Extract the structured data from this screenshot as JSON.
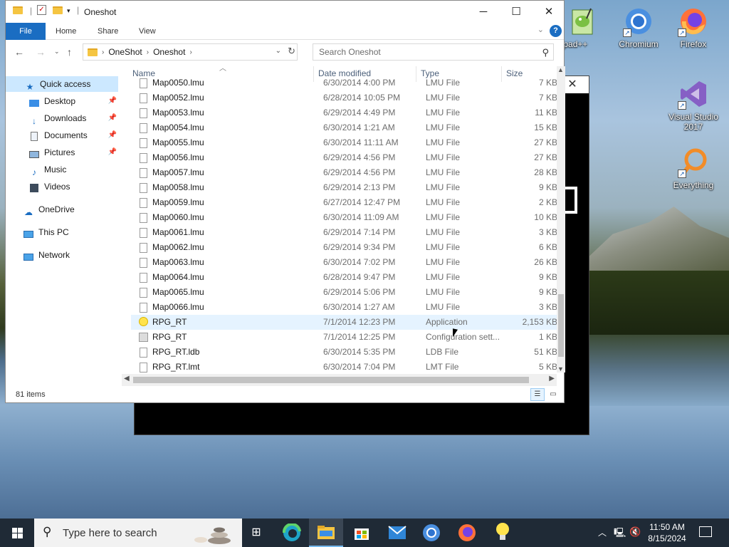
{
  "explorer": {
    "title": "Oneshot",
    "ribbon_tabs": [
      "File",
      "Home",
      "Share",
      "View"
    ],
    "address_path": [
      "OneShot",
      "Oneshot"
    ],
    "search_placeholder": "Search Oneshot",
    "columns": [
      "Name",
      "Date modified",
      "Type",
      "Size"
    ],
    "sidebar": [
      {
        "label": "Quick access",
        "icon": "star-icon",
        "active": true
      },
      {
        "label": "Desktop",
        "icon": "desktop-icon",
        "pinned": true
      },
      {
        "label": "Downloads",
        "icon": "download-icon",
        "pinned": true
      },
      {
        "label": "Documents",
        "icon": "documents-icon",
        "pinned": true
      },
      {
        "label": "Pictures",
        "icon": "pictures-icon",
        "pinned": true
      },
      {
        "label": "Music",
        "icon": "music-icon"
      },
      {
        "label": "Videos",
        "icon": "videos-icon"
      },
      {
        "label": "OneDrive",
        "icon": "cloud-icon"
      },
      {
        "label": "This PC",
        "icon": "computer-icon"
      },
      {
        "label": "Network",
        "icon": "network-icon"
      }
    ],
    "files": [
      {
        "name": "Map0050.lmu",
        "date": "6/30/2014 4:00 PM",
        "type": "LMU File",
        "size": "7 KB",
        "icon": "file-icon"
      },
      {
        "name": "Map0052.lmu",
        "date": "6/28/2014 10:05 PM",
        "type": "LMU File",
        "size": "7 KB",
        "icon": "file-icon"
      },
      {
        "name": "Map0053.lmu",
        "date": "6/29/2014 4:49 PM",
        "type": "LMU File",
        "size": "11 KB",
        "icon": "file-icon"
      },
      {
        "name": "Map0054.lmu",
        "date": "6/30/2014 1:21 AM",
        "type": "LMU File",
        "size": "15 KB",
        "icon": "file-icon"
      },
      {
        "name": "Map0055.lmu",
        "date": "6/30/2014 11:11 AM",
        "type": "LMU File",
        "size": "27 KB",
        "icon": "file-icon"
      },
      {
        "name": "Map0056.lmu",
        "date": "6/29/2014 4:56 PM",
        "type": "LMU File",
        "size": "27 KB",
        "icon": "file-icon"
      },
      {
        "name": "Map0057.lmu",
        "date": "6/29/2014 4:56 PM",
        "type": "LMU File",
        "size": "28 KB",
        "icon": "file-icon"
      },
      {
        "name": "Map0058.lmu",
        "date": "6/29/2014 2:13 PM",
        "type": "LMU File",
        "size": "9 KB",
        "icon": "file-icon"
      },
      {
        "name": "Map0059.lmu",
        "date": "6/27/2014 12:47 PM",
        "type": "LMU File",
        "size": "2 KB",
        "icon": "file-icon"
      },
      {
        "name": "Map0060.lmu",
        "date": "6/30/2014 11:09 AM",
        "type": "LMU File",
        "size": "10 KB",
        "icon": "file-icon"
      },
      {
        "name": "Map0061.lmu",
        "date": "6/29/2014 7:14 PM",
        "type": "LMU File",
        "size": "3 KB",
        "icon": "file-icon"
      },
      {
        "name": "Map0062.lmu",
        "date": "6/29/2014 9:34 PM",
        "type": "LMU File",
        "size": "6 KB",
        "icon": "file-icon"
      },
      {
        "name": "Map0063.lmu",
        "date": "6/30/2014 7:02 PM",
        "type": "LMU File",
        "size": "26 KB",
        "icon": "file-icon"
      },
      {
        "name": "Map0064.lmu",
        "date": "6/28/2014 9:47 PM",
        "type": "LMU File",
        "size": "9 KB",
        "icon": "file-icon"
      },
      {
        "name": "Map0065.lmu",
        "date": "6/29/2014 5:06 PM",
        "type": "LMU File",
        "size": "9 KB",
        "icon": "file-icon"
      },
      {
        "name": "Map0066.lmu",
        "date": "6/30/2014 1:27 AM",
        "type": "LMU File",
        "size": "3 KB",
        "icon": "file-icon"
      },
      {
        "name": "RPG_RT",
        "date": "7/1/2014 12:23 PM",
        "type": "Application",
        "size": "2,153 KB",
        "icon": "lightbulb-icon",
        "hover": true
      },
      {
        "name": "RPG_RT",
        "date": "7/1/2014 12:25 PM",
        "type": "Configuration sett...",
        "size": "1 KB",
        "icon": "config-icon"
      },
      {
        "name": "RPG_RT.ldb",
        "date": "6/30/2014 5:35 PM",
        "type": "LDB File",
        "size": "51 KB",
        "icon": "file-icon"
      },
      {
        "name": "RPG_RT.lmt",
        "date": "6/30/2014 7:04 PM",
        "type": "LMT File",
        "size": "5 KB",
        "icon": "file-icon"
      }
    ],
    "status": "81 items"
  },
  "desktop_icons": [
    {
      "label": "Notepad++",
      "icon": "notepadpp-icon"
    },
    {
      "label": "Chromium",
      "icon": "chromium-icon"
    },
    {
      "label": "Firefox",
      "icon": "firefox-icon"
    },
    {
      "label": "Visual Studio 2017",
      "icon": "visual-studio-icon"
    },
    {
      "label": "Everything",
      "icon": "everything-icon"
    }
  ],
  "taskbar": {
    "search_placeholder": "Type here to search",
    "apps": [
      "task-view-icon",
      "edge-icon",
      "file-explorer-icon",
      "store-icon",
      "mail-icon",
      "chromium-icon",
      "firefox-icon",
      "lightbulb-icon"
    ],
    "time": "11:50 AM",
    "date": "8/15/2024"
  },
  "colors": {
    "accent": "#1a6dc2",
    "selection": "#cce8ff",
    "hover_row": "#e5f3ff",
    "taskbar": "#1f2a36"
  }
}
